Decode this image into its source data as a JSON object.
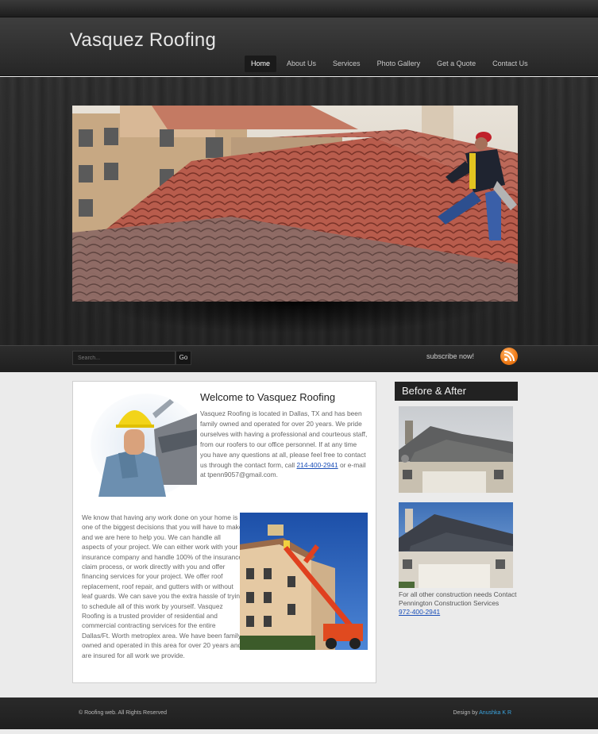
{
  "site": {
    "title": "Vasquez Roofing"
  },
  "nav": {
    "items": [
      {
        "label": "Home",
        "active": true
      },
      {
        "label": "About Us"
      },
      {
        "label": "Services"
      },
      {
        "label": "Photo Gallery"
      },
      {
        "label": "Get a Quote"
      },
      {
        "label": "Contact Us"
      }
    ]
  },
  "searchbar": {
    "placeholder": "Search...",
    "go_label": "Go",
    "subscribe_label": "subscribe now!",
    "rss_icon": "rss-icon"
  },
  "welcome": {
    "title": "Welcome to Vasquez Roofing",
    "text_before_phone": "Vasquez Roofing is located in Dallas, TX and has been family owned and operated for over 20 years. We pride ourselves with having a professional and courteous staff, from our roofers to our office personnel. If at any time you have any questions at all, please feel free to contact us through the contact form, call ",
    "phone": "214-400-2941",
    "text_after_phone": " or e-mail at tpenn9057@gmail.com."
  },
  "main": {
    "paragraph": "We know that having any work done on your home is one of the biggest decisions that you will have to make and we are here to help you. We can handle all aspects of your project. We can either work with your insurance company and handle 100% of the insurance claim process, or work directly with you and offer financing services for your project. We offer roof replacement, roof repair, and gutters with or without leaf guards. We can save you the extra hassle of trying to schedule all of this work by yourself. Vasquez Roofing is a trusted provider of residential and commercial contracting services for the entire Dallas/Ft. Worth metroplex area. We have been family owned and operated in this area for over 20 years and are insured for all work we provide."
  },
  "sidebar": {
    "title": "Before & After",
    "note": "For all other construction needs Contact Pennington Construction Services",
    "phone": "972-400-2941"
  },
  "footer": {
    "copyright": "© Roofing web. All Rights Reserved",
    "design_prefix": "Design by ",
    "designer": "Anushka K R"
  },
  "colors": {
    "header_bg": "#2e2e2e",
    "link": "#1b4fb8",
    "rss": "#ef7a16",
    "designer_link": "#3ba5e0"
  }
}
